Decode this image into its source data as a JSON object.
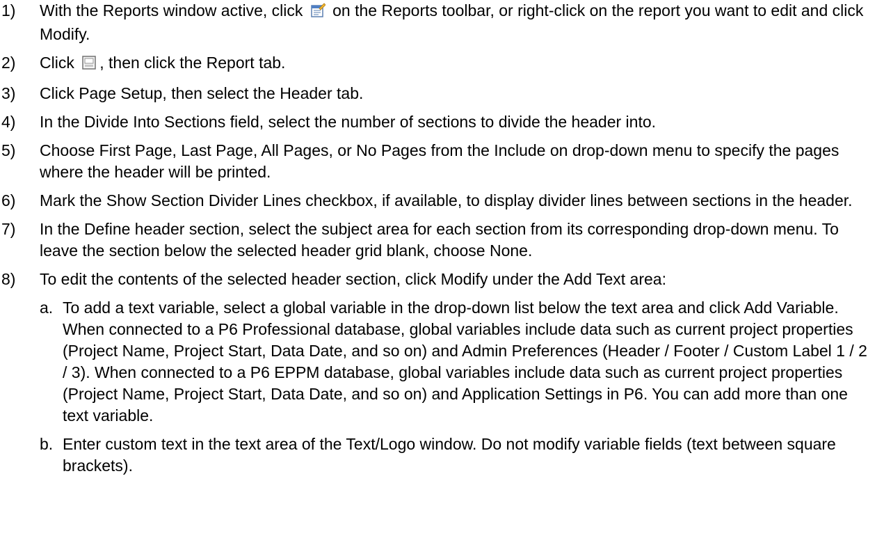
{
  "steps": [
    {
      "num": "1)",
      "pre": "With the Reports window active, click",
      "icon": "modify-report-icon",
      "post": "on the Reports toolbar, or right-click on the report you want to edit and click Modify."
    },
    {
      "num": "2)",
      "pre": "Click",
      "icon": "page-setup-icon",
      "post": ", then click the Report tab."
    },
    {
      "num": "3)",
      "text": "Click Page Setup, then select the Header tab."
    },
    {
      "num": "4)",
      "text": "In the Divide Into Sections field, select the number of sections to divide the header into."
    },
    {
      "num": "5)",
      "text": "Choose First Page, Last Page, All Pages, or No Pages from the Include on drop-down menu to specify the pages where the header will be printed."
    },
    {
      "num": "6)",
      "text": "Mark the Show Section Divider Lines checkbox, if available, to display divider lines between sections in the header."
    },
    {
      "num": "7)",
      "text": "In the Define header section, select the subject area for each section from its corresponding drop-down menu. To leave the section below the selected header grid blank, choose None."
    },
    {
      "num": "8)",
      "text": "To edit the contents of the selected header section, click Modify under the Add Text area:"
    }
  ],
  "substeps": [
    {
      "letter": "a.",
      "text": "To add a text variable, select a global variable in the drop-down list below the text area and click Add Variable. When connected to a P6 Professional database, global variables include data such as current project properties (Project Name, Project Start, Data Date, and so on) and Admin Preferences (Header / Footer / Custom Label 1 / 2 / 3). When connected to a P6 EPPM database, global variables include data such as current project properties (Project Name, Project Start, Data Date, and so on) and Application Settings in P6. You can add more than one text variable."
    },
    {
      "letter": "b.",
      "text": "Enter custom text in the text area of the Text/Logo window. Do not modify variable fields (text between square brackets)."
    }
  ]
}
